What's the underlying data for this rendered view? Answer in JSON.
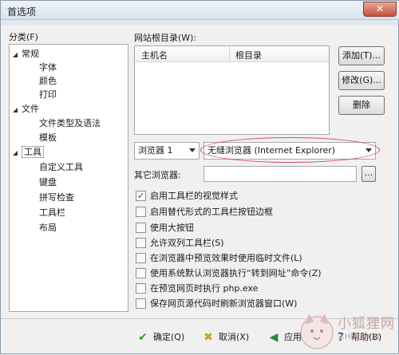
{
  "window": {
    "title": "首选项",
    "close_symbol": "✕"
  },
  "tree": {
    "label": "分类(F)",
    "items": [
      {
        "label": "常规",
        "level": 0,
        "expanded": true
      },
      {
        "label": "字体",
        "level": 1
      },
      {
        "label": "颜色",
        "level": 1
      },
      {
        "label": "打印",
        "level": 1
      },
      {
        "label": "文件",
        "level": 0,
        "expanded": true
      },
      {
        "label": "文件类型及语法",
        "level": 1
      },
      {
        "label": "模板",
        "level": 1
      },
      {
        "label": "工具",
        "level": 0,
        "expanded": true,
        "selected": true
      },
      {
        "label": "自定义工具",
        "level": 1
      },
      {
        "label": "键盘",
        "level": 1
      },
      {
        "label": "拼写检查",
        "level": 1
      },
      {
        "label": "工具栏",
        "level": 1
      },
      {
        "label": "布局",
        "level": 1
      }
    ]
  },
  "site_root": {
    "label": "网站根目录(W):",
    "columns": [
      "主机名",
      "根目录"
    ],
    "add_label": "添加(T)...",
    "edit_label": "修改(G)...",
    "delete_label": "删除"
  },
  "browser": {
    "selector_value": "浏览器 1",
    "browser_value": "无缝浏览器 (Internet Explorer)",
    "other_label": "其它浏览器:",
    "other_value": "",
    "browse_label": "..."
  },
  "options": [
    {
      "label": "启用工具栏的视觉样式",
      "checked": true
    },
    {
      "label": "启用替代形式的工具栏按钮边框",
      "checked": false
    },
    {
      "label": "使用大按钮",
      "checked": false
    },
    {
      "label": "允许双列工具栏(S)",
      "checked": false
    },
    {
      "label": "在浏览器中预览效果时使用临时文件(L)",
      "checked": false
    },
    {
      "label": "使用系统默认浏览器执行“转到网址”命令(Z)",
      "checked": false
    },
    {
      "label": "在预览网页时执行 php.exe",
      "checked": false
    },
    {
      "label": "保存网页源代码时刷新浏览器窗口(W)",
      "checked": false
    }
  ],
  "footer": {
    "ok_label": "确定(Q)",
    "cancel_label": "取消(X)",
    "apply_label": "应用(A)",
    "help_label": "帮助(B)"
  },
  "watermark": {
    "text": "小狐狸网",
    "url": "XHLKS.CN"
  },
  "colors": {
    "ok_icon": "#3a9a2a",
    "cancel_icon": "#c8a020",
    "apply_icon": "#2a8a3a",
    "help_icon": "#2a6ab0",
    "ellipse": "#d24a6a"
  }
}
